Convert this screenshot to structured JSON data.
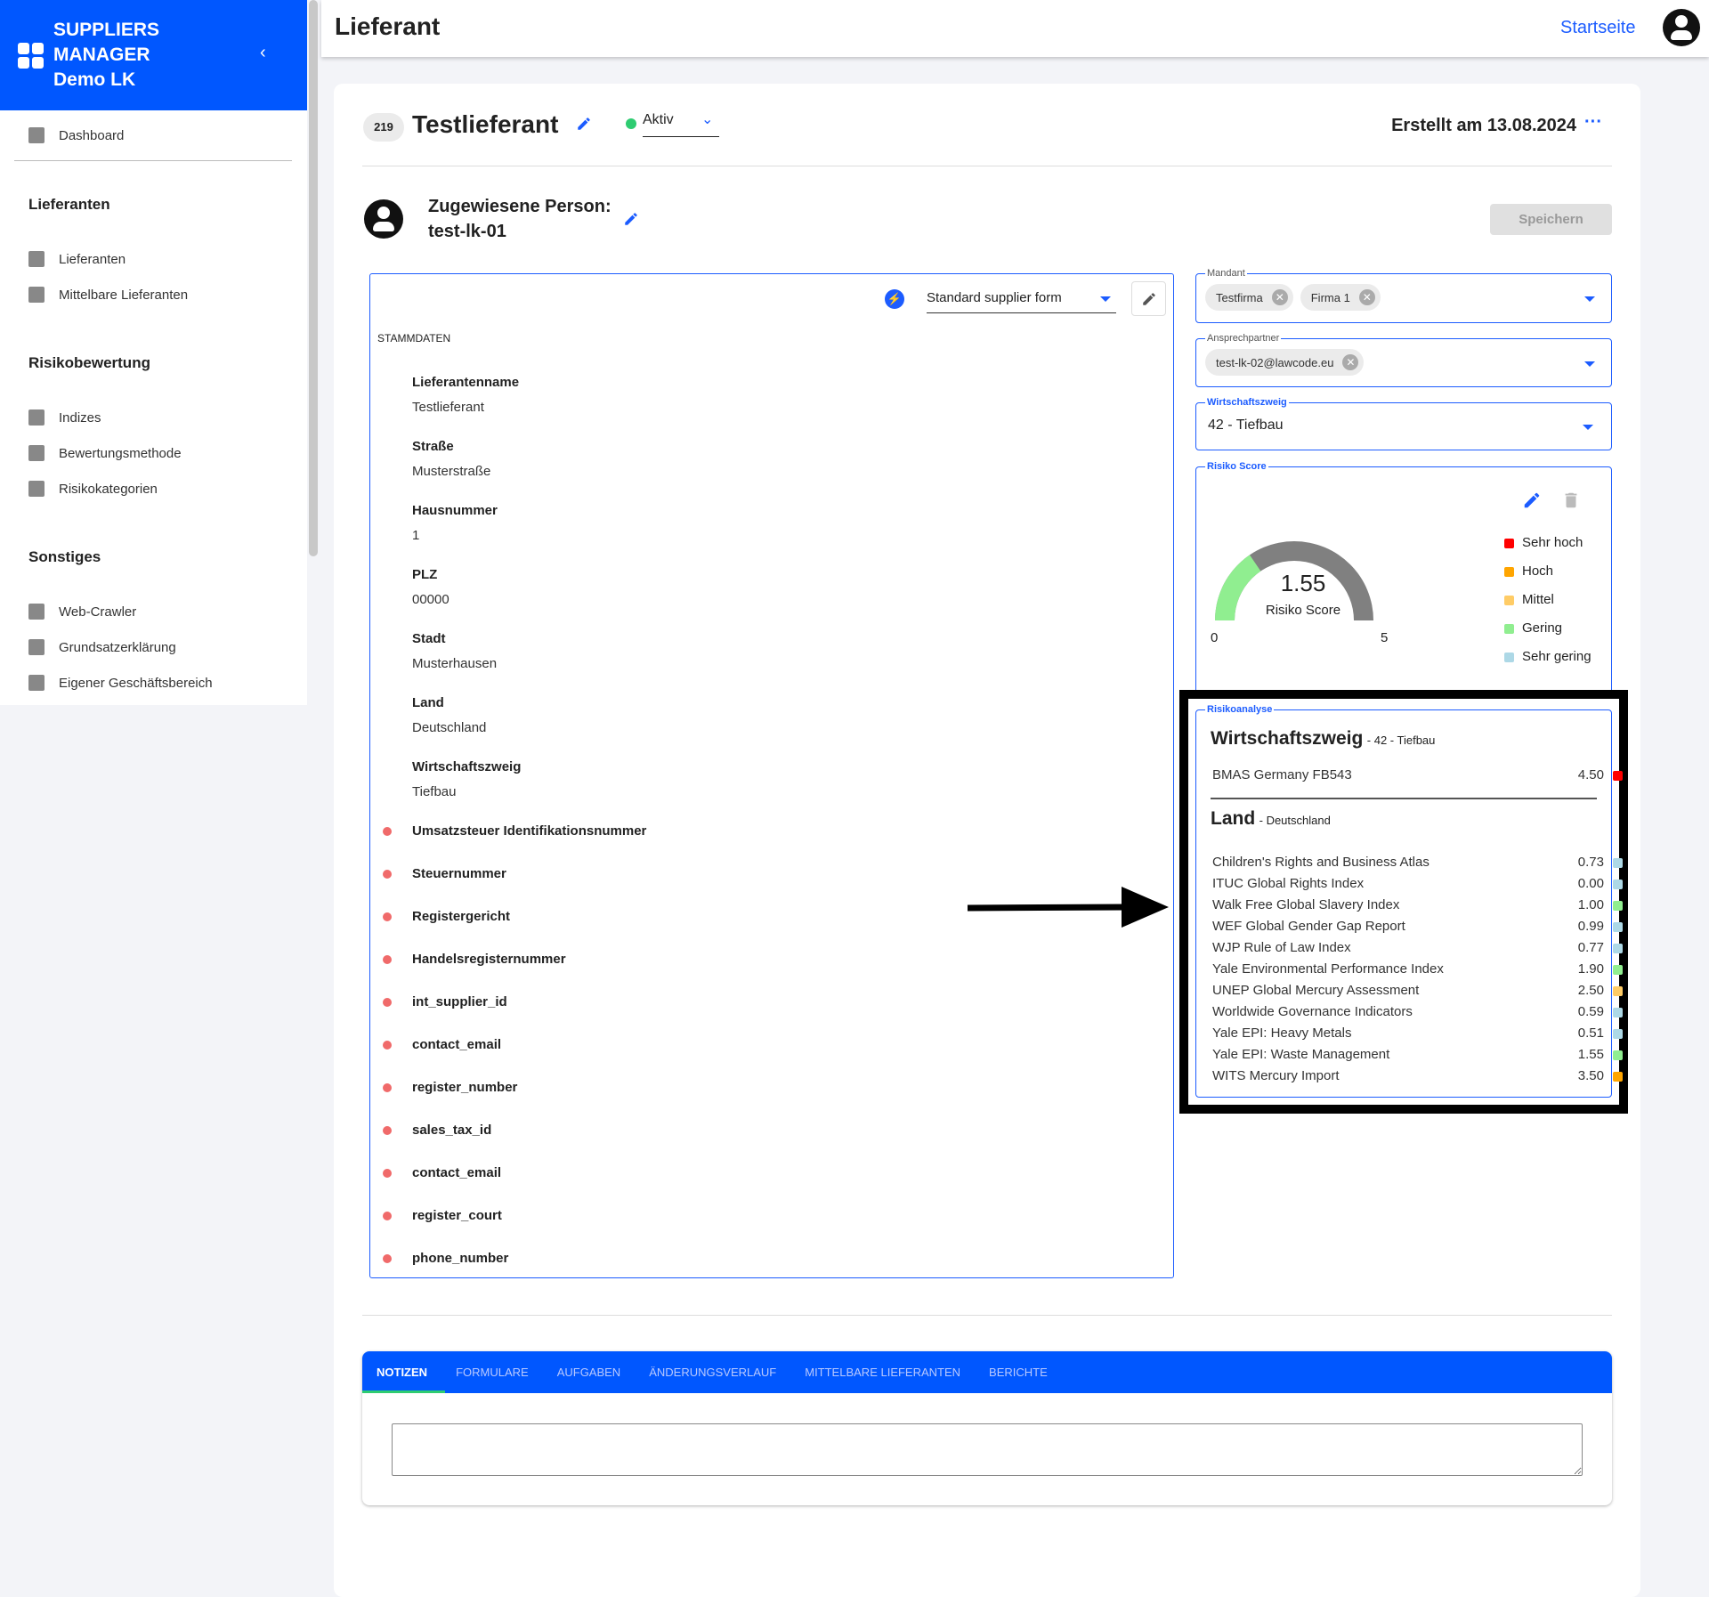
{
  "brand": {
    "line1": "SUPPLIERS",
    "line2": "MANAGER",
    "line3": "Demo LK"
  },
  "sidebar": {
    "dashboard": "Dashboard",
    "sections": [
      {
        "title": "Lieferanten",
        "items": [
          "Lieferanten",
          "Mittelbare Lieferanten"
        ]
      },
      {
        "title": "Risikobewertung",
        "items": [
          "Indizes",
          "Bewertungsmethode",
          "Risikokategorien"
        ]
      },
      {
        "title": "Sonstiges",
        "items": [
          "Web-Crawler",
          "Grundsatzerklärung",
          "Eigener Geschäftsbereich"
        ]
      }
    ]
  },
  "topbar": {
    "title": "Lieferant",
    "home_link": "Startseite"
  },
  "supplier": {
    "id": "219",
    "name": "Testlieferant",
    "status": "Aktiv",
    "status_color": "#2ecc71",
    "created": "Erstellt am 13.08.2024",
    "more": "···"
  },
  "assigned": {
    "label": "Zugewiesene Person:",
    "value": "test-lk-01",
    "save": "Speichern"
  },
  "form": {
    "selected_form": "Standard supplier form",
    "section": "STAMMDATEN",
    "fields": [
      {
        "label": "Lieferantenname",
        "value": "Testlieferant"
      },
      {
        "label": "Straße",
        "value": "Musterstraße"
      },
      {
        "label": "Hausnummer",
        "value": "1"
      },
      {
        "label": "PLZ",
        "value": "00000"
      },
      {
        "label": "Stadt",
        "value": "Musterhausen"
      },
      {
        "label": "Land",
        "value": "Deutschland"
      },
      {
        "label": "Wirtschaftszweig",
        "value": "Tiefbau"
      }
    ],
    "missing_fields": [
      "Umsatzsteuer Identifikationsnummer",
      "Steuernummer",
      "Registergericht",
      "Handelsregisternummer",
      "int_supplier_id",
      "contact_email",
      "register_number",
      "sales_tax_id",
      "contact_email",
      "register_court",
      "phone_number"
    ]
  },
  "mandant": {
    "label": "Mandant",
    "chips": [
      "Testfirma",
      "Firma 1"
    ]
  },
  "contact": {
    "label": "Ansprechpartner",
    "chips": [
      "test-lk-02@lawcode.eu"
    ]
  },
  "industry": {
    "label": "Wirtschaftszweig",
    "value": "42 - Tiefbau"
  },
  "risk_score": {
    "label": "Risiko Score",
    "value": "1.55",
    "score": 1.55,
    "min": "0",
    "max": "5",
    "caption": "Risiko Score",
    "legend": [
      {
        "label": "Sehr hoch",
        "color": "#ff0000"
      },
      {
        "label": "Hoch",
        "color": "#ffa500"
      },
      {
        "label": "Mittel",
        "color": "#ffcc66"
      },
      {
        "label": "Gering",
        "color": "#90ee90"
      },
      {
        "label": "Sehr gering",
        "color": "#add8e6"
      }
    ]
  },
  "analysis": {
    "label": "Risikoanalyse",
    "industry_title": "Wirtschaftszweig",
    "industry_sub": "- 42 - Tiefbau",
    "industry_rows": [
      {
        "name": "BMAS Germany FB543",
        "value": "4.50",
        "color": "#ff0000"
      }
    ],
    "country_title": "Land",
    "country_sub": "- Deutschland",
    "country_rows": [
      {
        "name": "Children's Rights and Business Atlas",
        "value": "0.73",
        "color": "#add8e6"
      },
      {
        "name": "ITUC Global Rights Index",
        "value": "0.00",
        "color": "#add8e6"
      },
      {
        "name": "Walk Free Global Slavery Index",
        "value": "1.00",
        "color": "#90ee90"
      },
      {
        "name": "WEF Global Gender Gap Report",
        "value": "0.99",
        "color": "#add8e6"
      },
      {
        "name": "WJP Rule of Law Index",
        "value": "0.77",
        "color": "#add8e6"
      },
      {
        "name": "Yale Environmental Performance Index",
        "value": "1.90",
        "color": "#90ee90"
      },
      {
        "name": "UNEP Global Mercury Assessment",
        "value": "2.50",
        "color": "#ffcc66"
      },
      {
        "name": "Worldwide Governance Indicators",
        "value": "0.59",
        "color": "#add8e6"
      },
      {
        "name": "Yale EPI: Heavy Metals",
        "value": "0.51",
        "color": "#add8e6"
      },
      {
        "name": "Yale EPI: Waste Management",
        "value": "1.55",
        "color": "#90ee90"
      },
      {
        "name": "WITS Mercury Import",
        "value": "3.50",
        "color": "#ffa500"
      }
    ]
  },
  "tabs": [
    "NOTIZEN",
    "FORMULARE",
    "AUFGABEN",
    "ÄNDERUNGSVERLAUF",
    "MITTELBARE LIEFERANTEN",
    "BERICHTE"
  ],
  "colors": {
    "accent": "#0057ff",
    "active_tab_indicator": "#2ecc71"
  }
}
